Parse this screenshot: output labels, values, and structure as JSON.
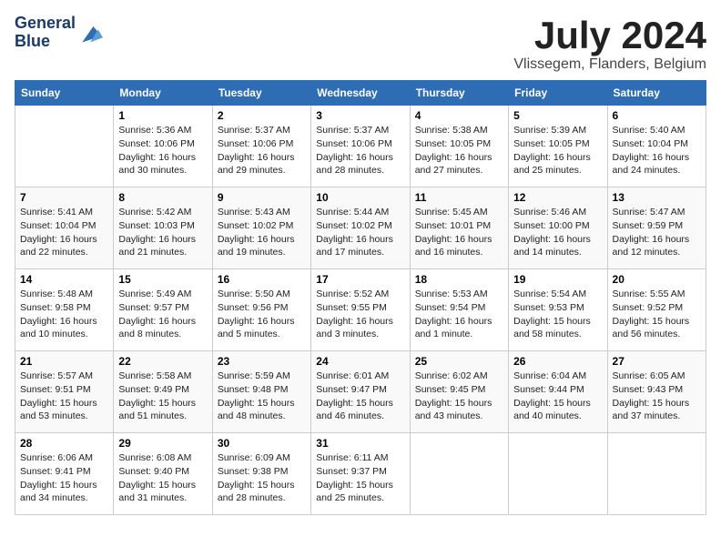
{
  "logo": {
    "line1": "General",
    "line2": "Blue"
  },
  "title": "July 2024",
  "subtitle": "Vlissegem, Flanders, Belgium",
  "weekdays": [
    "Sunday",
    "Monday",
    "Tuesday",
    "Wednesday",
    "Thursday",
    "Friday",
    "Saturday"
  ],
  "weeks": [
    [
      {
        "day": "",
        "info": ""
      },
      {
        "day": "1",
        "info": "Sunrise: 5:36 AM\nSunset: 10:06 PM\nDaylight: 16 hours\nand 30 minutes."
      },
      {
        "day": "2",
        "info": "Sunrise: 5:37 AM\nSunset: 10:06 PM\nDaylight: 16 hours\nand 29 minutes."
      },
      {
        "day": "3",
        "info": "Sunrise: 5:37 AM\nSunset: 10:06 PM\nDaylight: 16 hours\nand 28 minutes."
      },
      {
        "day": "4",
        "info": "Sunrise: 5:38 AM\nSunset: 10:05 PM\nDaylight: 16 hours\nand 27 minutes."
      },
      {
        "day": "5",
        "info": "Sunrise: 5:39 AM\nSunset: 10:05 PM\nDaylight: 16 hours\nand 25 minutes."
      },
      {
        "day": "6",
        "info": "Sunrise: 5:40 AM\nSunset: 10:04 PM\nDaylight: 16 hours\nand 24 minutes."
      }
    ],
    [
      {
        "day": "7",
        "info": "Sunrise: 5:41 AM\nSunset: 10:04 PM\nDaylight: 16 hours\nand 22 minutes."
      },
      {
        "day": "8",
        "info": "Sunrise: 5:42 AM\nSunset: 10:03 PM\nDaylight: 16 hours\nand 21 minutes."
      },
      {
        "day": "9",
        "info": "Sunrise: 5:43 AM\nSunset: 10:02 PM\nDaylight: 16 hours\nand 19 minutes."
      },
      {
        "day": "10",
        "info": "Sunrise: 5:44 AM\nSunset: 10:02 PM\nDaylight: 16 hours\nand 17 minutes."
      },
      {
        "day": "11",
        "info": "Sunrise: 5:45 AM\nSunset: 10:01 PM\nDaylight: 16 hours\nand 16 minutes."
      },
      {
        "day": "12",
        "info": "Sunrise: 5:46 AM\nSunset: 10:00 PM\nDaylight: 16 hours\nand 14 minutes."
      },
      {
        "day": "13",
        "info": "Sunrise: 5:47 AM\nSunset: 9:59 PM\nDaylight: 16 hours\nand 12 minutes."
      }
    ],
    [
      {
        "day": "14",
        "info": "Sunrise: 5:48 AM\nSunset: 9:58 PM\nDaylight: 16 hours\nand 10 minutes."
      },
      {
        "day": "15",
        "info": "Sunrise: 5:49 AM\nSunset: 9:57 PM\nDaylight: 16 hours\nand 8 minutes."
      },
      {
        "day": "16",
        "info": "Sunrise: 5:50 AM\nSunset: 9:56 PM\nDaylight: 16 hours\nand 5 minutes."
      },
      {
        "day": "17",
        "info": "Sunrise: 5:52 AM\nSunset: 9:55 PM\nDaylight: 16 hours\nand 3 minutes."
      },
      {
        "day": "18",
        "info": "Sunrise: 5:53 AM\nSunset: 9:54 PM\nDaylight: 16 hours\nand 1 minute."
      },
      {
        "day": "19",
        "info": "Sunrise: 5:54 AM\nSunset: 9:53 PM\nDaylight: 15 hours\nand 58 minutes."
      },
      {
        "day": "20",
        "info": "Sunrise: 5:55 AM\nSunset: 9:52 PM\nDaylight: 15 hours\nand 56 minutes."
      }
    ],
    [
      {
        "day": "21",
        "info": "Sunrise: 5:57 AM\nSunset: 9:51 PM\nDaylight: 15 hours\nand 53 minutes."
      },
      {
        "day": "22",
        "info": "Sunrise: 5:58 AM\nSunset: 9:49 PM\nDaylight: 15 hours\nand 51 minutes."
      },
      {
        "day": "23",
        "info": "Sunrise: 5:59 AM\nSunset: 9:48 PM\nDaylight: 15 hours\nand 48 minutes."
      },
      {
        "day": "24",
        "info": "Sunrise: 6:01 AM\nSunset: 9:47 PM\nDaylight: 15 hours\nand 46 minutes."
      },
      {
        "day": "25",
        "info": "Sunrise: 6:02 AM\nSunset: 9:45 PM\nDaylight: 15 hours\nand 43 minutes."
      },
      {
        "day": "26",
        "info": "Sunrise: 6:04 AM\nSunset: 9:44 PM\nDaylight: 15 hours\nand 40 minutes."
      },
      {
        "day": "27",
        "info": "Sunrise: 6:05 AM\nSunset: 9:43 PM\nDaylight: 15 hours\nand 37 minutes."
      }
    ],
    [
      {
        "day": "28",
        "info": "Sunrise: 6:06 AM\nSunset: 9:41 PM\nDaylight: 15 hours\nand 34 minutes."
      },
      {
        "day": "29",
        "info": "Sunrise: 6:08 AM\nSunset: 9:40 PM\nDaylight: 15 hours\nand 31 minutes."
      },
      {
        "day": "30",
        "info": "Sunrise: 6:09 AM\nSunset: 9:38 PM\nDaylight: 15 hours\nand 28 minutes."
      },
      {
        "day": "31",
        "info": "Sunrise: 6:11 AM\nSunset: 9:37 PM\nDaylight: 15 hours\nand 25 minutes."
      },
      {
        "day": "",
        "info": ""
      },
      {
        "day": "",
        "info": ""
      },
      {
        "day": "",
        "info": ""
      }
    ]
  ]
}
